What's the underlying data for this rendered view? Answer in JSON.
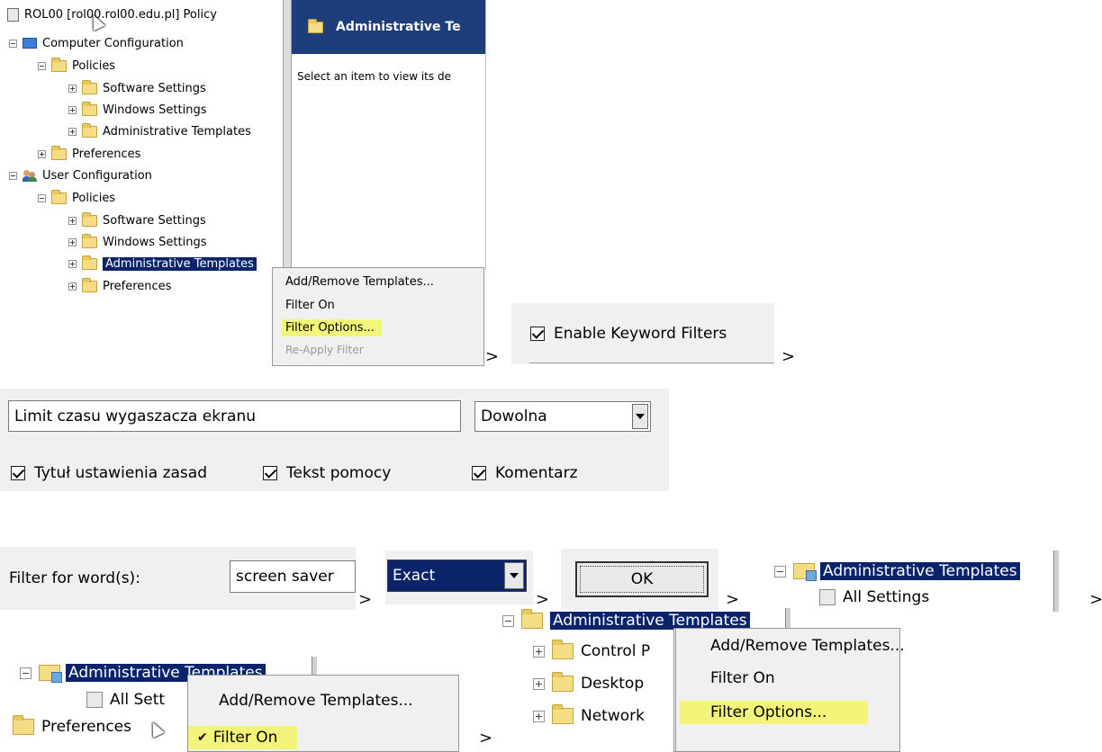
{
  "colors": {
    "selection": "#0a246a",
    "highlight": "#f3f57a",
    "menu_bg": "#f0f0f0",
    "panel_bg": "#f0f0f0"
  },
  "separator": ">",
  "step1": {
    "tree": {
      "root": "ROL00 [rol00.rol00.edu.pl] Policy",
      "computer_config": "Computer Configuration",
      "cc_policies": "Policies",
      "cc_software": "Software Settings",
      "cc_windows": "Windows Settings",
      "cc_admin": "Administrative Templates",
      "cc_preferences": "Preferences",
      "user_config": "User Configuration",
      "uc_policies": "Policies",
      "uc_software": "Software Settings",
      "uc_windows": "Windows Settings",
      "uc_admin": "Administrative Templates",
      "uc_preferences": "Preferences"
    },
    "detail": {
      "header": "Administrative Te",
      "body": "Select an item to view its de"
    },
    "menu": {
      "add_remove": "Add/Remove Templates...",
      "filter_on": "Filter On",
      "filter_options": "Filter Options...",
      "reapply": "Re-Apply Filter"
    }
  },
  "step2": {
    "enable_keyword": "Enable Keyword Filters"
  },
  "step3": {
    "keyword_value": "Limit czasu wygaszacza ekranu",
    "match_type": "Dowolna",
    "opt_title": "Tytuł ustawienia zasad",
    "opt_help": "Tekst pomocy",
    "opt_comment": "Komentarz"
  },
  "step4": {
    "filter_label": "Filter for word(s):",
    "filter_value": "screen saver",
    "match_type": "Exact",
    "ok_label": "OK"
  },
  "step5": {
    "admin_templates": "Administrative Templates",
    "all_settings": "All Settings"
  },
  "step6": {
    "admin_templates": "Administrative Templates",
    "all_settings": "All Sett",
    "preferences": "Preferences",
    "menu": {
      "add_remove": "Add/Remove Templates...",
      "filter_on": "Filter On"
    }
  },
  "step7": {
    "admin_templates": "Administrative Templates",
    "control": "Control P",
    "desktop": "Desktop",
    "network": "Network",
    "menu": {
      "add_remove": "Add/Remove Templates...",
      "filter_on": "Filter On",
      "filter_options": "Filter Options..."
    }
  }
}
